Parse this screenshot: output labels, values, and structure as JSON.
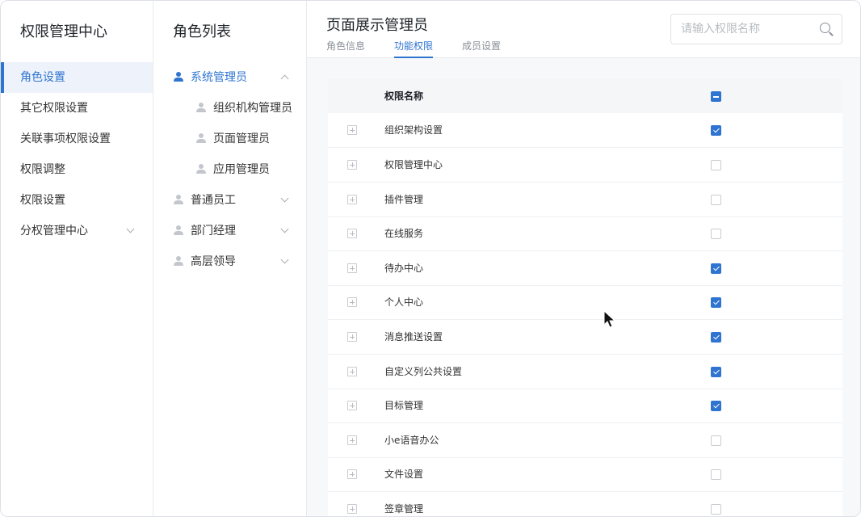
{
  "left_panel": {
    "title": "权限管理中心",
    "items": [
      {
        "label": "角色设置",
        "active": true
      },
      {
        "label": "其它权限设置"
      },
      {
        "label": "关联事项权限设置"
      },
      {
        "label": "权限调整"
      },
      {
        "label": "权限设置"
      },
      {
        "label": "分权管理中心",
        "expandable": true
      }
    ]
  },
  "role_panel": {
    "title": "角色列表",
    "roles": [
      {
        "label": "系统管理员",
        "level": "parent",
        "active": true,
        "expanded": true
      },
      {
        "label": "组织机构管理员",
        "level": "child"
      },
      {
        "label": "页面管理员",
        "level": "child"
      },
      {
        "label": "应用管理员",
        "level": "child"
      },
      {
        "label": "普通员工",
        "level": "parent"
      },
      {
        "label": "部门经理",
        "level": "parent"
      },
      {
        "label": "高层领导",
        "level": "parent"
      }
    ]
  },
  "main": {
    "title": "页面展示管理员",
    "tabs": [
      {
        "label": "角色信息"
      },
      {
        "label": "功能权限",
        "active": true
      },
      {
        "label": "成员设置"
      }
    ],
    "search": {
      "placeholder": "请输入权限名称",
      "value": ""
    },
    "table": {
      "header": {
        "name": "权限名称",
        "select_all_state": "partial"
      },
      "rows": [
        {
          "name": "组织架构设置",
          "checked": true
        },
        {
          "name": "权限管理中心",
          "checked": false
        },
        {
          "name": "插件管理",
          "checked": false
        },
        {
          "name": "在线服务",
          "checked": false
        },
        {
          "name": "待办中心",
          "checked": true
        },
        {
          "name": "个人中心",
          "checked": true
        },
        {
          "name": "消息推送设置",
          "checked": true
        },
        {
          "name": "自定义列公共设置",
          "checked": true
        },
        {
          "name": "目标管理",
          "checked": true
        },
        {
          "name": "小e语音办公",
          "checked": false
        },
        {
          "name": "文件设置",
          "checked": false
        },
        {
          "name": "签章管理",
          "checked": false
        }
      ]
    }
  },
  "colors": {
    "accent": "#2f74d0",
    "active_bg": "#eef3fb",
    "border": "#e8eaee"
  },
  "icons": {
    "search": "search-icon",
    "expand": "plus-square-icon",
    "role": "person-icon",
    "chevron": "chevron-down-icon"
  }
}
